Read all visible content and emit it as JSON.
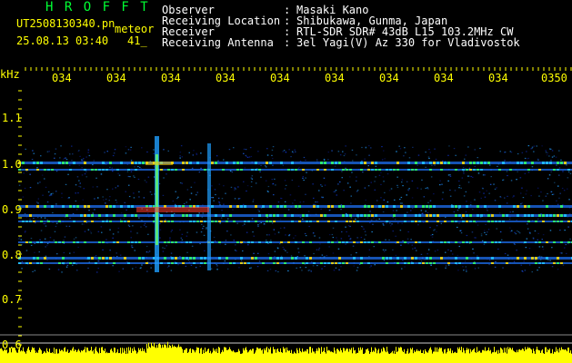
{
  "header": {
    "app_name": "H R O F F T",
    "file_name": "UT2508130340.pn",
    "mode_label": "meteor",
    "datetime": "25.08.13 03:40",
    "count": "41_",
    "info_rows": [
      {
        "label": "Observer",
        "sep": ":",
        "value": "Masaki Kano"
      },
      {
        "label": "Receiving Location",
        "sep": ":",
        "value": "Shibukawa, Gunma, Japan"
      },
      {
        "label": "Receiver",
        "sep": ":",
        "value": "RTL-SDR SDR# 43dB L15 103.2MHz CW"
      },
      {
        "label": "Receiving Antenna",
        "sep": ":",
        "value": "3el Yagi(V) Az 330 for Vladivostok"
      }
    ]
  },
  "axis": {
    "unit_label": "kHz",
    "y_ticks": [
      "1.1",
      "1.0",
      "0.9",
      "0.8",
      "0.7",
      "0.6"
    ],
    "x_ticks": [
      "034",
      "034",
      "034",
      "034",
      "034",
      "034",
      "034",
      "034",
      "034",
      "0350"
    ]
  },
  "colors": {
    "background": "#000000",
    "header_text": "#ffffff",
    "axis_text": "#ffff00",
    "app_name": "#00ff33",
    "power_bar": "#ffff00",
    "spectrum_low": "#0000aa",
    "spectrum_high": "#ff2000"
  }
}
